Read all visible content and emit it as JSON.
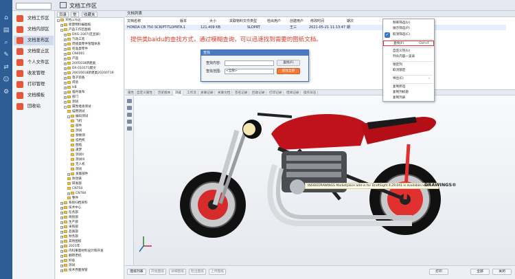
{
  "app": {
    "title": "文档工作区"
  },
  "search": {
    "placeholder": ""
  },
  "nav": [
    {
      "label": "文档工作区"
    },
    {
      "label": "文档内部区"
    },
    {
      "label": "文档发布区"
    },
    {
      "label": "文档废止区"
    },
    {
      "label": "个人文件区"
    },
    {
      "label": "收发管理"
    },
    {
      "label": "打印管理"
    },
    {
      "label": "文档模板"
    },
    {
      "label": "回收站"
    }
  ],
  "tree_tabs": {
    "dir": "目录",
    "favorites": "常",
    "saved": "收藏夹"
  },
  "tree": [
    {
      "label": "文档工作区",
      "level": 0,
      "pm": "-"
    },
    {
      "label": "新建物料编图纸",
      "level": 1,
      "pm": "+"
    },
    {
      "label": "产品工作区图纸",
      "level": 1,
      "pm": "-"
    },
    {
      "label": "DXG-1007(区显屏)",
      "level": 2,
      "pm": "+"
    },
    {
      "label": "气动工装",
      "level": 2,
      "pm": "+"
    },
    {
      "label": "焊接类零件管理体系",
      "level": 2,
      "pm": "+"
    },
    {
      "label": "标准类零件",
      "level": 2,
      "pm": "+"
    },
    {
      "label": "CN0001",
      "level": 2,
      "pm": "+"
    },
    {
      "label": "产品",
      "level": 2,
      "pm": "+"
    },
    {
      "label": "2005018新建类",
      "level": 2,
      "pm": "+"
    },
    {
      "label": "DX-010171腊文",
      "level": 2,
      "pm": "+"
    },
    {
      "label": "20010018新建类20200719",
      "level": 2,
      "pm": "+"
    },
    {
      "label": "电子装备",
      "level": 2,
      "pm": "+"
    },
    {
      "label": "焊装",
      "level": 2,
      "pm": "+"
    },
    {
      "label": "HB",
      "level": 2,
      "pm": "+"
    },
    {
      "label": "临时发布",
      "level": 2,
      "pm": "+"
    },
    {
      "label": "部门",
      "level": 2,
      "pm": "+"
    },
    {
      "label": "测试",
      "level": 2,
      "pm": "+"
    },
    {
      "label": "属性继承测试",
      "level": 2,
      "pm": "-"
    },
    {
      "label": "描用测试",
      "level": 3,
      "pm": ""
    },
    {
      "label": "编码测试",
      "level": 3,
      "pm": "-"
    },
    {
      "label": "飞机",
      "level": 4,
      "pm": ""
    },
    {
      "label": "部件",
      "level": 4,
      "pm": ""
    },
    {
      "label": "测试",
      "level": 4,
      "pm": ""
    },
    {
      "label": "替换测",
      "level": 4,
      "pm": ""
    },
    {
      "label": "挂档机",
      "level": 4,
      "pm": ""
    },
    {
      "label": "图纸",
      "level": 4,
      "pm": ""
    },
    {
      "label": "逢梦",
      "level": 4,
      "pm": ""
    },
    {
      "label": "测试II",
      "level": 4,
      "pm": ""
    },
    {
      "label": "测试III",
      "level": 4,
      "pm": ""
    },
    {
      "label": "无人机",
      "level": 4,
      "pm": ""
    },
    {
      "label": "测试",
      "level": 4,
      "pm": ""
    },
    {
      "label": "发版部件",
      "level": 3,
      "pm": "+"
    },
    {
      "label": "防伪链",
      "level": 3,
      "pm": ""
    },
    {
      "label": "研发部",
      "level": 3,
      "pm": ""
    },
    {
      "label": "CN750",
      "level": 3,
      "pm": ""
    },
    {
      "label": "CN760",
      "level": 3,
      "pm": "+"
    },
    {
      "label": "整件",
      "level": 3,
      "pm": ""
    },
    {
      "label": "系统归档资料",
      "level": 1,
      "pm": "+"
    },
    {
      "label": "技术中心",
      "level": 1,
      "pm": "+"
    },
    {
      "label": "任务部",
      "level": 1,
      "pm": "+"
    },
    {
      "label": "规划部",
      "level": 1,
      "pm": "+"
    },
    {
      "label": "生产部",
      "level": 1,
      "pm": "+"
    },
    {
      "label": "采购部",
      "level": 1,
      "pm": "+"
    },
    {
      "label": "品质部",
      "level": 1,
      "pm": "+"
    },
    {
      "label": "财务部",
      "level": 1,
      "pm": "+"
    },
    {
      "label": "其他图纸",
      "level": 1,
      "pm": "+"
    },
    {
      "label": "2021年",
      "level": 1,
      "pm": "+"
    },
    {
      "label": "内科重量材料设计和开发",
      "level": 1,
      "pm": "+"
    },
    {
      "label": "翻转老机",
      "level": 1,
      "pm": "+"
    },
    {
      "label": "好舍",
      "level": 1,
      "pm": "+"
    },
    {
      "label": "测试",
      "level": 1,
      "pm": "+"
    },
    {
      "label": "技术界面保管",
      "level": 1,
      "pm": "+"
    }
  ],
  "list": {
    "header": "文档列表",
    "columns": [
      "文档名称",
      "版本",
      "大小",
      "关联物料",
      "文件类型",
      "检出用户",
      "创建用户",
      "修改时间",
      "期次"
    ],
    "row": [
      "HONDA CB 750 SCRIPT-TLDPRT",
      "A.1",
      "121,409 KB",
      "",
      "SLDPRT",
      "",
      "王三",
      "2021-05-21 11:13:47",
      "期"
    ]
  },
  "annotation": "提供类baidu的查找方式，通过模糊查询，可以迅速找到需要的图纸文档。",
  "find_dialog": {
    "title": "查找",
    "content_label": "查找内容:",
    "content_value": "",
    "scope_label": "查找范围:",
    "scope_value": "<全部>",
    "find_next": "查找(F)",
    "find_all": "提找全部(A)>>"
  },
  "detail_tabs": [
    "属性",
    "自定义属性",
    "历史版本",
    "浏览",
    "工作流",
    "关联记录",
    "关联文档",
    "签名记录",
    "回收记录",
    "打印记录",
    "借阅记录",
    "操作日志"
  ],
  "viewer": {
    "info_text": "INSIDEDRAWINGS Marketplace add-in for DraftSight 4.29.041 is available now...",
    "logo_text": "DRAWINGS®",
    "logo_sub": "INSIDE"
  },
  "bottom_buttons": {
    "browse_list": "图纸列表",
    "open_file": "开始图纸",
    "detail": "详细图纸",
    "sign_out": "检出图纸",
    "upload": "上传图纸",
    "print": "打印",
    "all": "全部",
    "close": "关闭"
  },
  "context_menu": [
    {
      "label": "频率筛选(U)",
      "shortcut": ""
    },
    {
      "label": "展示筛选(P)",
      "shortcut": ""
    },
    {
      "label": "取消筛选(C)",
      "shortcut": ""
    },
    {
      "label": "查找(F)",
      "shortcut": "Ctrl+F"
    },
    {
      "label": "自定义列(U)",
      "shortcut": ""
    },
    {
      "label": "列头内容一览表",
      "shortcut": ""
    },
    {
      "label": "锁定列",
      "shortcut": ""
    },
    {
      "label": "取消锁定",
      "shortcut": ""
    },
    {
      "label": "导出(E)",
      "shortcut": ""
    },
    {
      "label": "复制所选",
      "shortcut": ""
    },
    {
      "label": "复制列标题",
      "shortcut": ""
    },
    {
      "label": "复制列表",
      "shortcut": ""
    }
  ],
  "colors": {
    "rail": "#2e5d96",
    "nav_icon": "#e5583e",
    "accent": "#3a78c5",
    "highlight": "#e0312b",
    "annotation": "#e03a2a"
  }
}
